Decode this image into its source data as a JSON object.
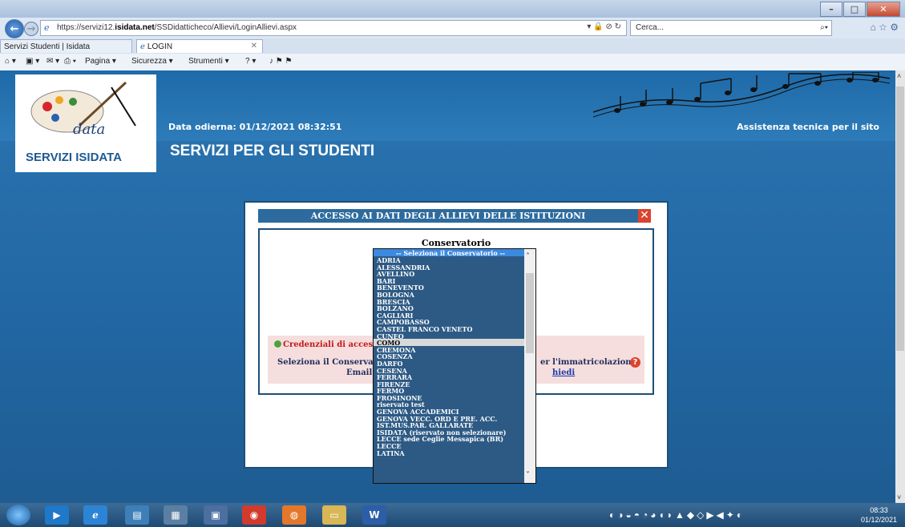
{
  "browser": {
    "url_prefix": "https://servizi12.",
    "url_domain": "isidata.net",
    "url_path": "/SSDidatticheco/Allievi/LoginAllievi.aspx",
    "search_placeholder": "Cerca...",
    "tabs": [
      {
        "label": "Servizi Studenti | Isidata"
      },
      {
        "label": "LOGIN"
      }
    ],
    "commands": {
      "pagina": "Pagina ▾",
      "sicurezza": "Sicurezza ▾",
      "strumenti": "Strumenti ▾"
    }
  },
  "header": {
    "logo_text": "SERVIZI ISIDATA",
    "date": "Data odierna: 01/12/2021 08:32:51",
    "support": "Assistenza tecnica per il sito",
    "main_title": "SERVIZI PER GLI STUDENTI"
  },
  "dialog": {
    "title": "ACCESSO AI DATI DEGLI ALLIEVI DELLE ISTITUZIONI",
    "close": "✕",
    "conservatorio_label": "Conservatorio",
    "credenziali": "Credenziali di accesso",
    "seleziona": "Seleziona il Conservator",
    "immatricolazione": "er l'immatricolazione",
    "email_label": "Email:",
    "richiedi": "hiedi"
  },
  "dropdown": {
    "placeholder": "-- Seleziona il Conservatorio --",
    "hovered": "COMO",
    "options": [
      "ADRIA",
      "ALESSANDRIA",
      "AVELLINO",
      "BARI",
      "BENEVENTO",
      "BOLOGNA",
      "BRESCIA",
      "BOLZANO",
      "CAGLIARI",
      "CAMPOBASSO",
      "CASTEL FRANCO VENETO",
      "CUNEO",
      "COMO",
      "CREMONA",
      "COSENZA",
      "DARFO",
      "CESENA",
      "FERRARA",
      "FIRENZE",
      "FERMO",
      "FROSINONE",
      "riservato test",
      "GENOVA ACCADEMICI",
      "GENOVA VECC. ORD E PRE. ACC.",
      "IST.MUS.PAR. GALLARATE",
      "ISIDATA (riservato non selezionare)",
      "LECCE sede Ceglie Messapica (BR)",
      "LECCE",
      "LATINA"
    ]
  },
  "taskbar": {
    "time": "08:33",
    "date": "01/12/2021"
  }
}
